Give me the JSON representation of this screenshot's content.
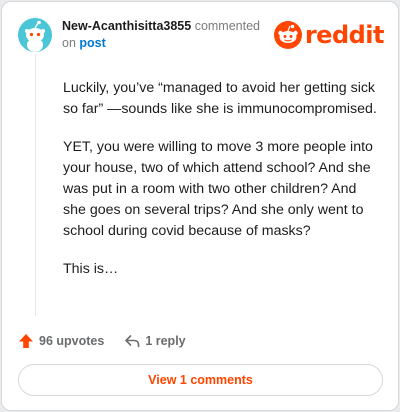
{
  "header": {
    "username": "New-Acanthisitta3855",
    "action_text": " commented",
    "on_text": "on ",
    "post_link": "post",
    "logo_text": "reddit"
  },
  "comment": {
    "paragraphs": [
      "Luckily, you’ve “managed to avoid her getting sick so far” —sounds like she is immunocompromised.",
      "YET, you were willing to move 3 more people into your house, two of which attend school? And she was put in a room with two other children? And she goes on several trips? And she only went to school during covid because of masks?",
      "This is…"
    ]
  },
  "actions": {
    "upvotes_label": "96 upvotes",
    "reply_label": "1 reply"
  },
  "footer": {
    "view_comments_label": "View 1 comments"
  },
  "colors": {
    "brand": "#ff4500",
    "avatar_bg": "#4bc6d6",
    "link": "#0079d3"
  },
  "icons": {
    "avatar": "snoo-avatar-icon",
    "logo": "reddit-snoo-icon",
    "upvote": "upvote-arrow-icon",
    "reply": "reply-arrow-icon"
  }
}
